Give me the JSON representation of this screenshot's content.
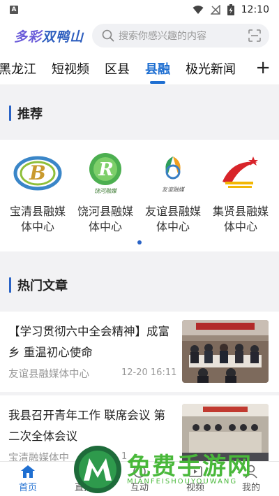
{
  "status_bar": {
    "time": "12:10",
    "left_badge": "A"
  },
  "header": {
    "logo_part1": "多彩",
    "logo_part2": "双鸭山",
    "search_placeholder": "搜索你感兴趣的内容"
  },
  "tabs": {
    "items": [
      "黑龙江",
      "短视频",
      "区县",
      "县融",
      "极光新闻"
    ],
    "active": "县融",
    "add": "+"
  },
  "recommend": {
    "title": "推荐",
    "items": [
      {
        "line1": "宝清县融媒",
        "line2": "体中心",
        "logo_caption": ""
      },
      {
        "line1": "饶河县融媒",
        "line2": "体中心",
        "logo_caption": "饶河融媒"
      },
      {
        "line1": "友谊县融媒",
        "line2": "体中心",
        "logo_caption": "友谊融媒"
      },
      {
        "line1": "集贤县融媒",
        "line2": "体中心",
        "logo_caption": ""
      }
    ]
  },
  "hot": {
    "title": "热门文章",
    "articles": [
      {
        "title": "【学习贯彻六中全会精神】成富乡 重温初心使命",
        "source": "友谊县融媒体中心",
        "time": "12-20 16:11"
      },
      {
        "title": "我县召开青年工作 联席会议 第二次全体会议",
        "source": "宝清融媒体中",
        "time": "1"
      }
    ]
  },
  "bottom_nav": {
    "items": [
      "首页",
      "直播",
      "互动",
      "视频",
      "我的"
    ],
    "active": "首页"
  },
  "watermark": {
    "text": "免费手游网",
    "sub": "MIANFEISHOUYOUWANG"
  },
  "colors": {
    "accent": "#1f6fd1",
    "section_bar": "#2a63c6",
    "watermark": "#49b83a"
  }
}
